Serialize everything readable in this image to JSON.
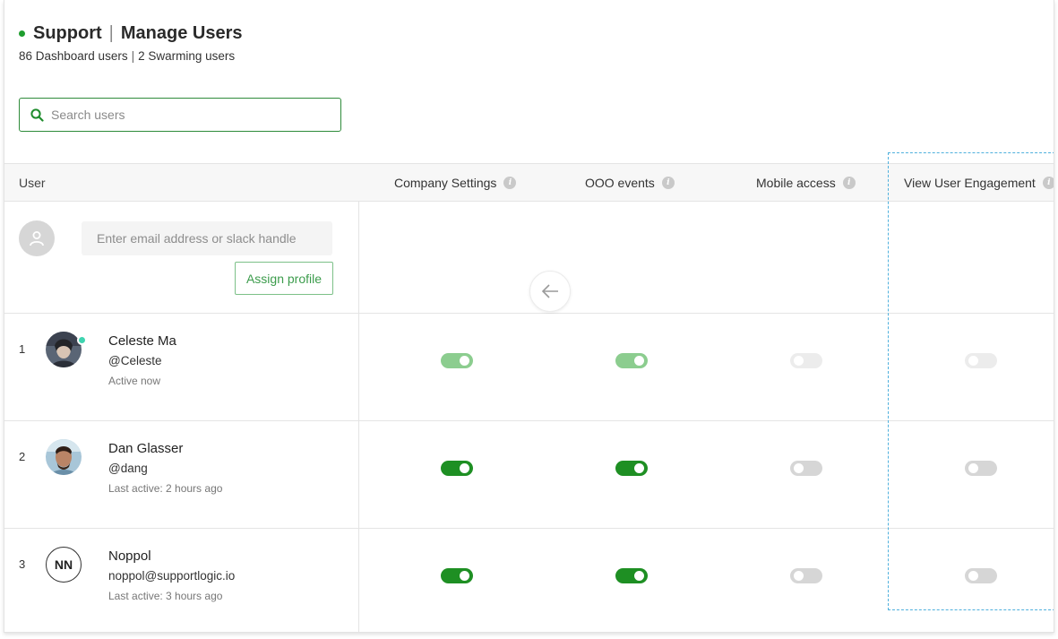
{
  "header": {
    "team": "Support",
    "title": "Manage Users",
    "dashboard_users": "86 Dashboard users",
    "separator": "|",
    "swarming_users": "2 Swarming users"
  },
  "search": {
    "placeholder": "Search users",
    "value": ""
  },
  "table": {
    "user_header": "User",
    "columns": [
      {
        "label": "Company Settings"
      },
      {
        "label": "OOO events"
      },
      {
        "label": "Mobile access"
      },
      {
        "label": "View User Engagement"
      }
    ]
  },
  "assign": {
    "placeholder": "Enter email address or slack handle",
    "button_label": "Assign profile"
  },
  "users": [
    {
      "index": "1",
      "name": "Celeste Ma",
      "handle": "@Celeste",
      "activity": "Active now",
      "online": true,
      "avatar": "photo-icon",
      "toggles": [
        {
          "on": true,
          "state": "muted"
        },
        {
          "on": true,
          "state": "muted"
        },
        {
          "on": false,
          "state": "muted"
        },
        {
          "on": false,
          "state": "muted"
        }
      ]
    },
    {
      "index": "2",
      "name": "Dan Glasser",
      "handle": "@dang",
      "activity": "Last active: 2 hours ago",
      "online": false,
      "avatar": "photo-icon",
      "toggles": [
        {
          "on": true,
          "state": "normal"
        },
        {
          "on": true,
          "state": "normal"
        },
        {
          "on": false,
          "state": "normal"
        },
        {
          "on": false,
          "state": "normal"
        }
      ]
    },
    {
      "index": "3",
      "name": "Noppol",
      "handle": "noppol@supportlogic.io",
      "activity": "Last active: 3 hours ago",
      "online": false,
      "initials": "NN",
      "toggles": [
        {
          "on": true,
          "state": "normal"
        },
        {
          "on": true,
          "state": "normal"
        },
        {
          "on": false,
          "state": "normal"
        },
        {
          "on": false,
          "state": "normal"
        }
      ]
    }
  ],
  "colors": {
    "accent": "#1f9d2e",
    "toggle_on": "#1e8f23",
    "toggle_on_muted": "#8ccd8f",
    "toggle_off": "#d6d6d6",
    "toggle_off_muted": "#ececec",
    "highlight": "#4fb0dd"
  }
}
